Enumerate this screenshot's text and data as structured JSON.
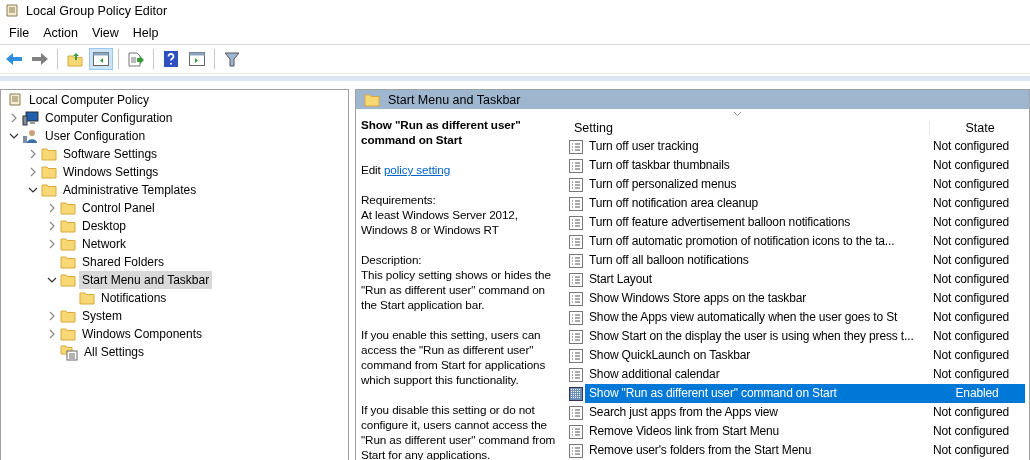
{
  "window": {
    "title": "Local Group Policy Editor"
  },
  "menu": [
    "File",
    "Action",
    "View",
    "Help"
  ],
  "toolbar": [
    {
      "kind": "back",
      "pressed": false
    },
    {
      "kind": "forward",
      "pressed": false
    },
    {
      "kind": "sep"
    },
    {
      "kind": "up",
      "pressed": false
    },
    {
      "kind": "pane",
      "pressed": true
    },
    {
      "kind": "sep"
    },
    {
      "kind": "export",
      "pressed": false
    },
    {
      "kind": "sep"
    },
    {
      "kind": "help",
      "pressed": false
    },
    {
      "kind": "pane2",
      "pressed": false
    },
    {
      "kind": "sep"
    },
    {
      "kind": "filter",
      "pressed": false
    }
  ],
  "tree": [
    {
      "label": "Local Computer Policy",
      "kind": "policy",
      "selected": false,
      "children": [
        {
          "label": "Computer Configuration",
          "kind": "computer",
          "has_children": true,
          "expanded": false,
          "selected": false
        },
        {
          "label": "User Configuration",
          "kind": "user",
          "has_children": true,
          "expanded": true,
          "selected": false,
          "children": [
            {
              "label": "Software Settings",
              "kind": "folder",
              "has_children": true,
              "expanded": false,
              "selected": false
            },
            {
              "label": "Windows Settings",
              "kind": "folder",
              "has_children": true,
              "expanded": false,
              "selected": false
            },
            {
              "label": "Administrative Templates",
              "kind": "folder",
              "has_children": true,
              "expanded": true,
              "selected": false,
              "children": [
                {
                  "label": "Control Panel",
                  "kind": "folder",
                  "has_children": true,
                  "expanded": false,
                  "selected": false
                },
                {
                  "label": "Desktop",
                  "kind": "folder",
                  "has_children": true,
                  "expanded": false,
                  "selected": false
                },
                {
                  "label": "Network",
                  "kind": "folder",
                  "has_children": true,
                  "expanded": false,
                  "selected": false
                },
                {
                  "label": "Shared Folders",
                  "kind": "folder",
                  "has_children": false,
                  "expanded": false,
                  "selected": false
                },
                {
                  "label": "Start Menu and Taskbar",
                  "kind": "folder",
                  "has_children": true,
                  "expanded": true,
                  "selected": true,
                  "children": [
                    {
                      "label": "Notifications",
                      "kind": "folder",
                      "has_children": false,
                      "expanded": false,
                      "selected": false
                    }
                  ]
                },
                {
                  "label": "System",
                  "kind": "folder",
                  "has_children": true,
                  "expanded": false,
                  "selected": false
                },
                {
                  "label": "Windows Components",
                  "kind": "folder",
                  "has_children": true,
                  "expanded": false,
                  "selected": false
                },
                {
                  "label": "All Settings",
                  "kind": "settings",
                  "has_children": false,
                  "expanded": false,
                  "selected": false
                }
              ]
            }
          ]
        }
      ]
    }
  ],
  "header": {
    "title": "Start Menu and Taskbar"
  },
  "details": {
    "title": "Show \"Run as different user\" command on Start",
    "edit_prefix": "Edit",
    "edit_link": "policy setting",
    "requirements": [
      "Requirements:",
      "At least Windows Server 2012, Windows 8 or Windows RT"
    ],
    "description": [
      "Description:\nThis policy setting shows or hides the \"Run as different user\" command on the Start application bar.",
      "If you enable this setting, users can access the \"Run as different user\" command from Start for applications which support this functionality.",
      "If you disable this setting or do not configure it, users cannot access the \"Run as different user\" command from Start for any applications."
    ]
  },
  "table": {
    "columns": [
      "Setting",
      "State"
    ],
    "rows": [
      {
        "setting": "Turn off user tracking",
        "state": "Not configured",
        "selected": false
      },
      {
        "setting": "Turn off taskbar thumbnails",
        "state": "Not configured",
        "selected": false
      },
      {
        "setting": "Turn off personalized menus",
        "state": "Not configured",
        "selected": false
      },
      {
        "setting": "Turn off notification area cleanup",
        "state": "Not configured",
        "selected": false
      },
      {
        "setting": "Turn off feature advertisement balloon notifications",
        "state": "Not configured",
        "selected": false
      },
      {
        "setting": "Turn off automatic promotion of notification icons to the ta...",
        "state": "Not configured",
        "selected": false
      },
      {
        "setting": "Turn off all balloon notifications",
        "state": "Not configured",
        "selected": false
      },
      {
        "setting": "Start Layout",
        "state": "Not configured",
        "selected": false
      },
      {
        "setting": "Show Windows Store apps on the taskbar",
        "state": "Not configured",
        "selected": false
      },
      {
        "setting": "Show the Apps view automatically when the user goes to St",
        "state": "Not configured",
        "selected": false
      },
      {
        "setting": "Show Start on the display the user is using when they press t...",
        "state": "Not configured",
        "selected": false
      },
      {
        "setting": "Show QuickLaunch on Taskbar",
        "state": "Not configured",
        "selected": false
      },
      {
        "setting": "Show additional calendar",
        "state": "Not configured",
        "selected": false
      },
      {
        "setting": "Show \"Run as different user\" command on Start",
        "state": "Enabled",
        "selected": true
      },
      {
        "setting": "Search just apps from the Apps view",
        "state": "Not configured",
        "selected": false
      },
      {
        "setting": "Remove Videos link from Start Menu",
        "state": "Not configured",
        "selected": false
      },
      {
        "setting": "Remove user's folders from the Start Menu",
        "state": "Not configured",
        "selected": false
      }
    ]
  }
}
